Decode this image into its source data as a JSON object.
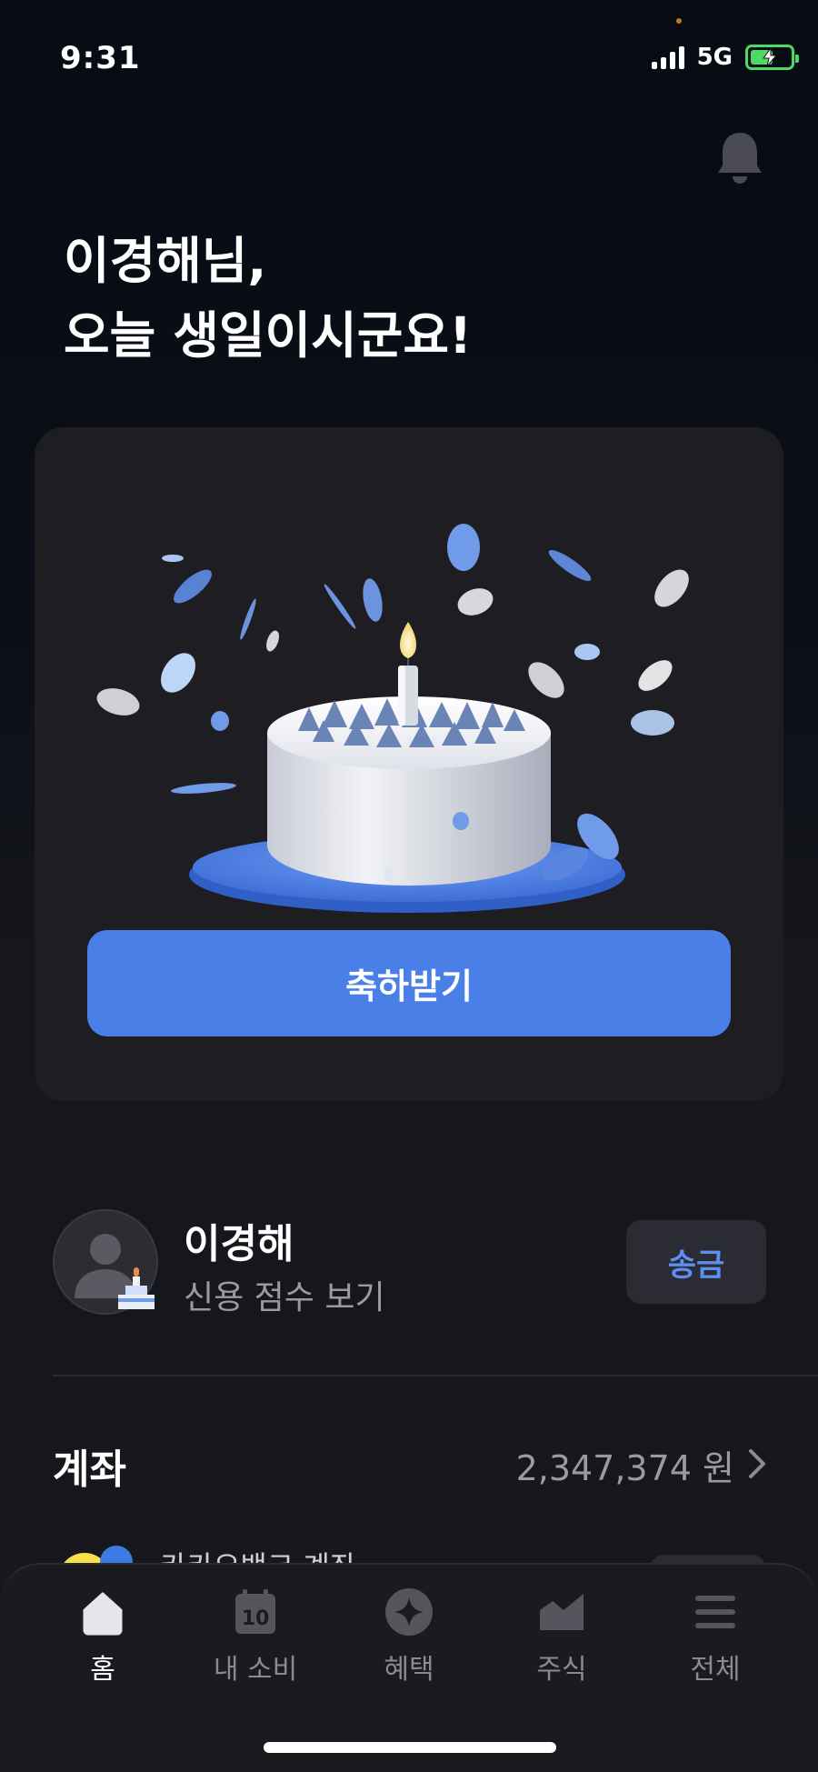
{
  "status": {
    "time": "9:31",
    "network": "5G",
    "battery_level": 0.5
  },
  "greeting": {
    "line1": "이경해님,",
    "line2": "오늘 생일이시군요!"
  },
  "card": {
    "button_label": "축하받기"
  },
  "profile": {
    "name": "이경해",
    "subtitle": "신용 점수 보기",
    "send_label": "송금"
  },
  "accounts": {
    "title": "계좌",
    "total": "2,347,374 원",
    "first_account_name": "카카오뱅크 계좌"
  },
  "tabs": [
    {
      "label": "홈",
      "icon": "home-icon",
      "active": true
    },
    {
      "label": "내 소비",
      "icon": "calendar-icon",
      "badge": "10"
    },
    {
      "label": "혜택",
      "icon": "sparkle-icon"
    },
    {
      "label": "주식",
      "icon": "chart-icon"
    },
    {
      "label": "전체",
      "icon": "menu-icon"
    }
  ],
  "colors": {
    "accent": "#4a7fe8",
    "background": "#0b0f18",
    "card": "#1e1e22",
    "battery": "#4cd964"
  }
}
